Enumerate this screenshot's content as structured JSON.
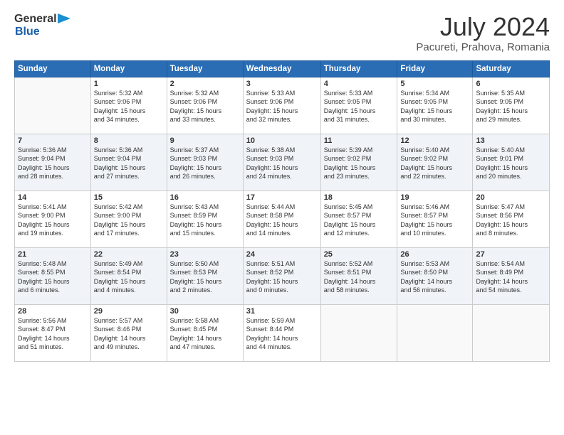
{
  "header": {
    "logo_general": "General",
    "logo_blue": "Blue",
    "month_year": "July 2024",
    "location": "Pacureti, Prahova, Romania"
  },
  "days": [
    "Sunday",
    "Monday",
    "Tuesday",
    "Wednesday",
    "Thursday",
    "Friday",
    "Saturday"
  ],
  "weeks": [
    [
      {
        "date": "",
        "info": ""
      },
      {
        "date": "1",
        "info": "Sunrise: 5:32 AM\nSunset: 9:06 PM\nDaylight: 15 hours\nand 34 minutes."
      },
      {
        "date": "2",
        "info": "Sunrise: 5:32 AM\nSunset: 9:06 PM\nDaylight: 15 hours\nand 33 minutes."
      },
      {
        "date": "3",
        "info": "Sunrise: 5:33 AM\nSunset: 9:06 PM\nDaylight: 15 hours\nand 32 minutes."
      },
      {
        "date": "4",
        "info": "Sunrise: 5:33 AM\nSunset: 9:05 PM\nDaylight: 15 hours\nand 31 minutes."
      },
      {
        "date": "5",
        "info": "Sunrise: 5:34 AM\nSunset: 9:05 PM\nDaylight: 15 hours\nand 30 minutes."
      },
      {
        "date": "6",
        "info": "Sunrise: 5:35 AM\nSunset: 9:05 PM\nDaylight: 15 hours\nand 29 minutes."
      }
    ],
    [
      {
        "date": "7",
        "info": "Sunrise: 5:36 AM\nSunset: 9:04 PM\nDaylight: 15 hours\nand 28 minutes."
      },
      {
        "date": "8",
        "info": "Sunrise: 5:36 AM\nSunset: 9:04 PM\nDaylight: 15 hours\nand 27 minutes."
      },
      {
        "date": "9",
        "info": "Sunrise: 5:37 AM\nSunset: 9:03 PM\nDaylight: 15 hours\nand 26 minutes."
      },
      {
        "date": "10",
        "info": "Sunrise: 5:38 AM\nSunset: 9:03 PM\nDaylight: 15 hours\nand 24 minutes."
      },
      {
        "date": "11",
        "info": "Sunrise: 5:39 AM\nSunset: 9:02 PM\nDaylight: 15 hours\nand 23 minutes."
      },
      {
        "date": "12",
        "info": "Sunrise: 5:40 AM\nSunset: 9:02 PM\nDaylight: 15 hours\nand 22 minutes."
      },
      {
        "date": "13",
        "info": "Sunrise: 5:40 AM\nSunset: 9:01 PM\nDaylight: 15 hours\nand 20 minutes."
      }
    ],
    [
      {
        "date": "14",
        "info": "Sunrise: 5:41 AM\nSunset: 9:00 PM\nDaylight: 15 hours\nand 19 minutes."
      },
      {
        "date": "15",
        "info": "Sunrise: 5:42 AM\nSunset: 9:00 PM\nDaylight: 15 hours\nand 17 minutes."
      },
      {
        "date": "16",
        "info": "Sunrise: 5:43 AM\nSunset: 8:59 PM\nDaylight: 15 hours\nand 15 minutes."
      },
      {
        "date": "17",
        "info": "Sunrise: 5:44 AM\nSunset: 8:58 PM\nDaylight: 15 hours\nand 14 minutes."
      },
      {
        "date": "18",
        "info": "Sunrise: 5:45 AM\nSunset: 8:57 PM\nDaylight: 15 hours\nand 12 minutes."
      },
      {
        "date": "19",
        "info": "Sunrise: 5:46 AM\nSunset: 8:57 PM\nDaylight: 15 hours\nand 10 minutes."
      },
      {
        "date": "20",
        "info": "Sunrise: 5:47 AM\nSunset: 8:56 PM\nDaylight: 15 hours\nand 8 minutes."
      }
    ],
    [
      {
        "date": "21",
        "info": "Sunrise: 5:48 AM\nSunset: 8:55 PM\nDaylight: 15 hours\nand 6 minutes."
      },
      {
        "date": "22",
        "info": "Sunrise: 5:49 AM\nSunset: 8:54 PM\nDaylight: 15 hours\nand 4 minutes."
      },
      {
        "date": "23",
        "info": "Sunrise: 5:50 AM\nSunset: 8:53 PM\nDaylight: 15 hours\nand 2 minutes."
      },
      {
        "date": "24",
        "info": "Sunrise: 5:51 AM\nSunset: 8:52 PM\nDaylight: 15 hours\nand 0 minutes."
      },
      {
        "date": "25",
        "info": "Sunrise: 5:52 AM\nSunset: 8:51 PM\nDaylight: 14 hours\nand 58 minutes."
      },
      {
        "date": "26",
        "info": "Sunrise: 5:53 AM\nSunset: 8:50 PM\nDaylight: 14 hours\nand 56 minutes."
      },
      {
        "date": "27",
        "info": "Sunrise: 5:54 AM\nSunset: 8:49 PM\nDaylight: 14 hours\nand 54 minutes."
      }
    ],
    [
      {
        "date": "28",
        "info": "Sunrise: 5:56 AM\nSunset: 8:47 PM\nDaylight: 14 hours\nand 51 minutes."
      },
      {
        "date": "29",
        "info": "Sunrise: 5:57 AM\nSunset: 8:46 PM\nDaylight: 14 hours\nand 49 minutes."
      },
      {
        "date": "30",
        "info": "Sunrise: 5:58 AM\nSunset: 8:45 PM\nDaylight: 14 hours\nand 47 minutes."
      },
      {
        "date": "31",
        "info": "Sunrise: 5:59 AM\nSunset: 8:44 PM\nDaylight: 14 hours\nand 44 minutes."
      },
      {
        "date": "",
        "info": ""
      },
      {
        "date": "",
        "info": ""
      },
      {
        "date": "",
        "info": ""
      }
    ]
  ]
}
